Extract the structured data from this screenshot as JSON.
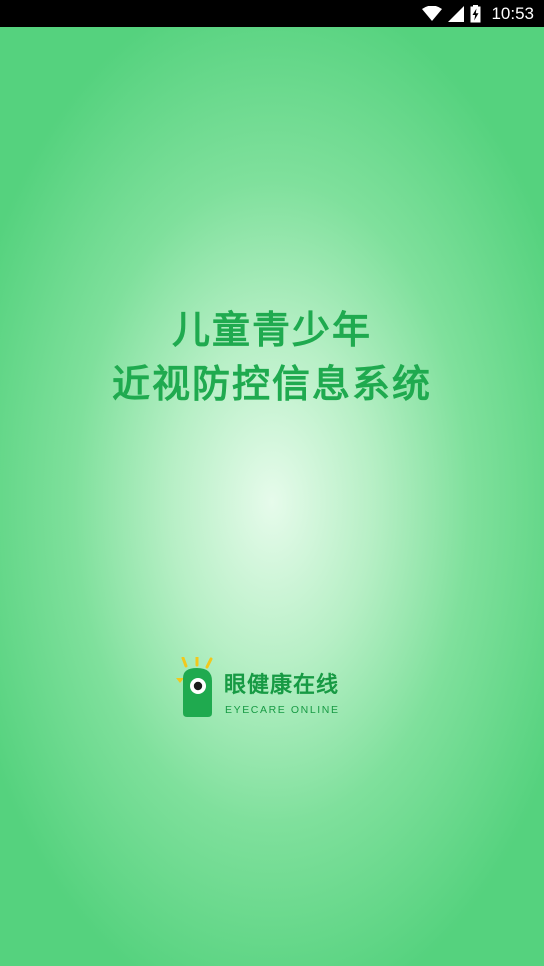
{
  "status_bar": {
    "time": "10:53",
    "icons": [
      "wifi-icon",
      "signal-icon",
      "battery-charging-icon"
    ]
  },
  "splash": {
    "title_line1": "儿童青少年",
    "title_line2": "近视防控信息系统"
  },
  "brand": {
    "name": "眼健康在线",
    "tagline": "EYECARE ONLINE",
    "colors": {
      "primary": "#1faa4f",
      "logo_green": "#1faa4f",
      "logo_yellow": "#f2c81b"
    }
  }
}
